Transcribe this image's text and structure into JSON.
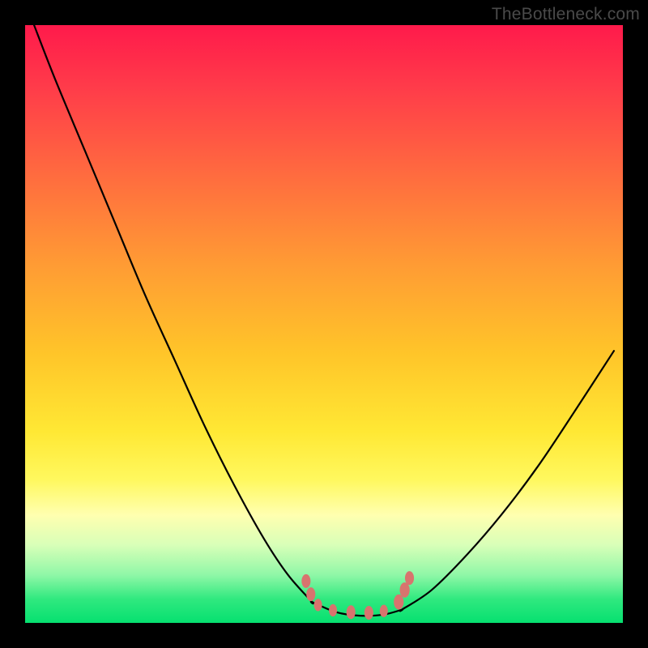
{
  "watermark": "TheBottleneck.com",
  "colors": {
    "frame": "#000000",
    "gradient_top": "#ff1a4b",
    "gradient_bottom": "#06e070",
    "curve": "#000000",
    "marker": "#d8746e"
  },
  "chart_data": {
    "type": "line",
    "title": "",
    "xlabel": "",
    "ylabel": "",
    "xlim": [
      0,
      1
    ],
    "ylim": [
      0,
      1
    ],
    "series": [
      {
        "name": "left-branch",
        "x": [
          0.015,
          0.05,
          0.1,
          0.15,
          0.2,
          0.25,
          0.3,
          0.35,
          0.4,
          0.44,
          0.48
        ],
        "y": [
          1.0,
          0.91,
          0.79,
          0.67,
          0.55,
          0.44,
          0.33,
          0.23,
          0.14,
          0.08,
          0.035
        ]
      },
      {
        "name": "flat-bottom",
        "x": [
          0.48,
          0.52,
          0.56,
          0.6,
          0.63
        ],
        "y": [
          0.035,
          0.018,
          0.012,
          0.014,
          0.022
        ]
      },
      {
        "name": "right-branch",
        "x": [
          0.63,
          0.68,
          0.74,
          0.8,
          0.86,
          0.92,
          0.985
        ],
        "y": [
          0.022,
          0.055,
          0.115,
          0.185,
          0.265,
          0.355,
          0.455
        ]
      }
    ],
    "markers": [
      {
        "x": 0.47,
        "y": 0.07,
        "r": 0.01
      },
      {
        "x": 0.478,
        "y": 0.048,
        "r": 0.01
      },
      {
        "x": 0.49,
        "y": 0.03,
        "r": 0.009
      },
      {
        "x": 0.515,
        "y": 0.021,
        "r": 0.009
      },
      {
        "x": 0.545,
        "y": 0.018,
        "r": 0.01
      },
      {
        "x": 0.575,
        "y": 0.017,
        "r": 0.01
      },
      {
        "x": 0.6,
        "y": 0.02,
        "r": 0.009
      },
      {
        "x": 0.625,
        "y": 0.035,
        "r": 0.011
      },
      {
        "x": 0.635,
        "y": 0.055,
        "r": 0.011
      },
      {
        "x": 0.643,
        "y": 0.075,
        "r": 0.01
      }
    ]
  }
}
